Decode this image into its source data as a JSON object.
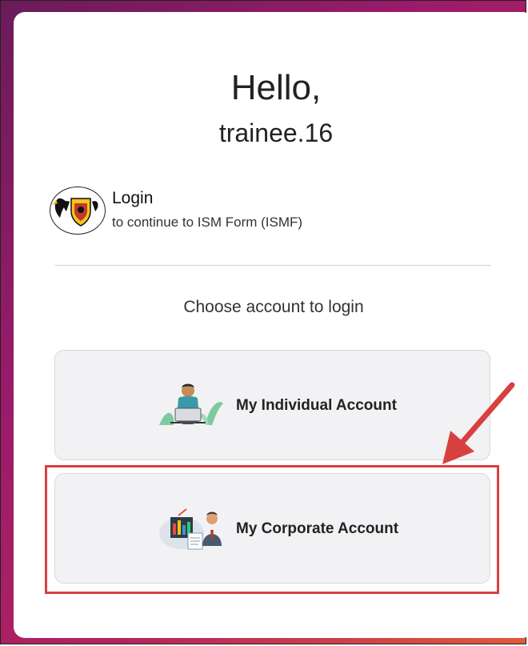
{
  "greeting": "Hello,",
  "username": "trainee.16",
  "login": {
    "title": "Login",
    "subtitle": "to continue to ISM Form (ISMF)"
  },
  "prompt": "Choose account to login",
  "accounts": [
    {
      "label": "My Individual Account",
      "icon": "person-laptop-icon"
    },
    {
      "label": "My Corporate Account",
      "icon": "corporate-office-icon"
    }
  ],
  "colors": {
    "annotation": "#d8403f",
    "background_gradient_start": "#6a1b5a",
    "background_gradient_end": "#e05a3a",
    "button_bg": "#f2f2f4"
  }
}
